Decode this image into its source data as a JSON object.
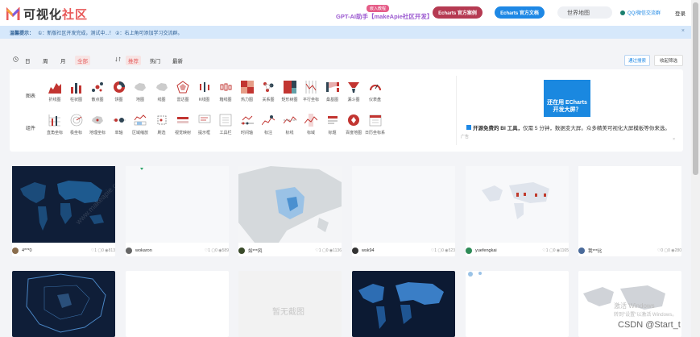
{
  "header": {
    "logo_text_a": "可视化",
    "logo_text_b": "社区",
    "gpt_badge": "嵌入教程",
    "gpt_link": "GPT-AI助手【makeApie社区开发】",
    "echarts_examples": "Echarts 官方案例",
    "echarts_docs": "Echarts 官方文档",
    "search_placeholder": "世界地图",
    "qq_group": "QQ/微信交流群",
    "login": "登录"
  },
  "notice": {
    "label": "温馨提示：",
    "text": "①：新版社区开发完成，测试中...！ ②：右上角可添加学习交流群。",
    "close": "×"
  },
  "filters": {
    "time": [
      "日",
      "周",
      "月",
      "全部"
    ],
    "active_time": "全部",
    "sort": [
      "推荐",
      "热门",
      "最新"
    ],
    "active_sort": "推荐",
    "advanced": "通过搜索",
    "collapse": "收起筛选"
  },
  "categories": {
    "chart_label": "图表",
    "component_label": "组件",
    "chart_items": [
      "折线图",
      "柱状图",
      "散点图",
      "饼图",
      "地图",
      "线图",
      "雷达图",
      "K线图",
      "箱线图",
      "热力图",
      "关系图",
      "矩形树图",
      "平行坐标",
      "桑基图",
      "漏斗图",
      "仪表盘"
    ],
    "component_items": [
      "直角坐标",
      "极坐标",
      "地理坐标",
      "单轴",
      "区域缩放",
      "刷选",
      "视觉映射",
      "提示框",
      "工具栏",
      "时间轴",
      "标注",
      "标线",
      "标域",
      "标题",
      "百度地图",
      "日历坐标系"
    ]
  },
  "ad": {
    "box_text_1": "还在用 ECharts",
    "box_text_2": "开发大屏？",
    "headline": "开源免费的 BI 工具，",
    "body": "仅需 5 分钟，数据变大屏。众多精美可视化大屏模板等你来选。",
    "note": "广告",
    "corner": "×"
  },
  "cards": [
    {
      "author": "4***0",
      "likes": "1",
      "comments": "0",
      "views": "813",
      "avatar_color": "#8a6d4d"
    },
    {
      "author": "wokaron",
      "likes": "1",
      "comments": "0",
      "views": "589",
      "avatar_color": "#666666"
    },
    {
      "author": "如***风",
      "likes": "1",
      "comments": "0",
      "views": "1136",
      "avatar_color": "#3a4a2a"
    },
    {
      "author": "wsk94",
      "likes": "1",
      "comments": "0",
      "views": "523",
      "avatar_color": "#333333"
    },
    {
      "author": "yuefengkai",
      "likes": "1",
      "comments": "0",
      "views": "1165",
      "avatar_color": "#2e8b57"
    },
    {
      "author": "我***比",
      "likes": "0",
      "comments": "0",
      "views": "280",
      "avatar_color": "#4a6a9a"
    }
  ],
  "placeholder_text": "暂无截图",
  "activate_windows": "激活 Windows",
  "activate_sub": "转到\"设置\"以激活 Windows。",
  "watermark_text": "www.makeapie.cn",
  "csdn": "CSDN @Start_t"
}
